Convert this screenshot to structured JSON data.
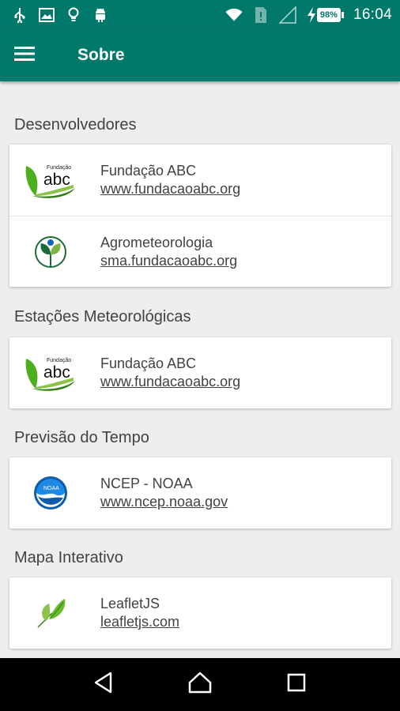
{
  "status_bar": {
    "time": "16:04",
    "battery": "98%",
    "icons": [
      "usb-icon",
      "image-icon",
      "lightbulb-icon",
      "android-icon",
      "wifi-icon",
      "sim-icon",
      "signal-icon",
      "charging-icon"
    ]
  },
  "appbar": {
    "title": "Sobre",
    "menu_icon": "menu-icon"
  },
  "sections": {
    "developers": {
      "title": "Desenvolvedores",
      "items": [
        {
          "name": "Fundação ABC",
          "link": "www.fundacaoabc.org",
          "logo": "fundacao-abc-logo"
        },
        {
          "name": "Agrometeorologia",
          "link": "sma.fundacaoabc.org",
          "logo": "agrometeorologia-logo"
        }
      ]
    },
    "stations": {
      "title": "Estações Meteorológicas",
      "items": [
        {
          "name": "Fundação ABC",
          "link": "www.fundacaoabc.org",
          "logo": "fundacao-abc-logo"
        }
      ]
    },
    "forecast": {
      "title": "Previsão do Tempo",
      "items": [
        {
          "name": "NCEP - NOAA",
          "link": "www.ncep.noaa.gov",
          "logo": "noaa-logo"
        }
      ]
    },
    "map": {
      "title": "Mapa Interativo",
      "items": [
        {
          "name": "LeafletJS",
          "link": "leafletjs.com",
          "logo": "leaflet-logo"
        }
      ]
    }
  },
  "logo_text": {
    "fundacao_small": "Fundação",
    "abc": "abc",
    "noaa": "NOAA"
  },
  "colors": {
    "primary": "#00796b",
    "background": "#eeeeee",
    "text": "#424242"
  }
}
